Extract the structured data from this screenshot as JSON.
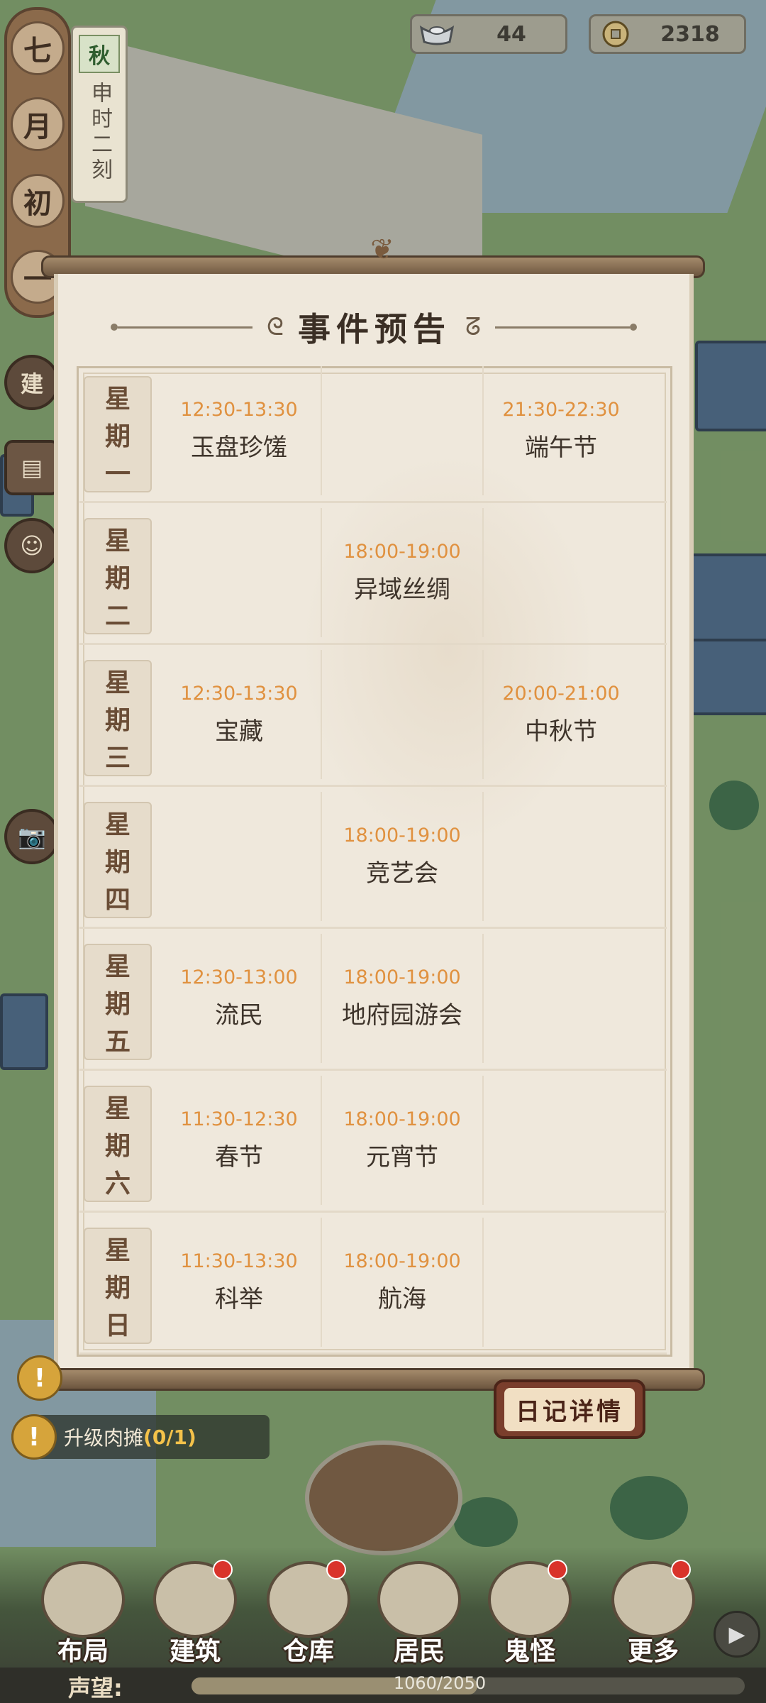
{
  "hud": {
    "date_chars": [
      "七",
      "月",
      "初",
      "一"
    ],
    "season": "秋",
    "time_text": "申时二刻",
    "silver": "44",
    "coins": "2318",
    "silver_icon": "silver-ingot-icon",
    "coin_icon": "copper-coin-icon"
  },
  "side_buttons": [
    "建",
    "📷"
  ],
  "panel": {
    "title": "事件预告",
    "days": [
      {
        "label": [
          "星",
          "期",
          "一"
        ],
        "events": [
          {
            "time": "12:30-13:30",
            "name": "玉盘珍馐"
          },
          {
            "time": "",
            "name": ""
          },
          {
            "time": "21:30-22:30",
            "name": "端午节"
          }
        ]
      },
      {
        "label": [
          "星",
          "期",
          "二"
        ],
        "events": [
          {
            "time": "",
            "name": ""
          },
          {
            "time": "18:00-19:00",
            "name": "异域丝绸"
          },
          {
            "time": "",
            "name": ""
          }
        ]
      },
      {
        "label": [
          "星",
          "期",
          "三"
        ],
        "events": [
          {
            "time": "12:30-13:30",
            "name": "宝藏"
          },
          {
            "time": "",
            "name": ""
          },
          {
            "time": "20:00-21:00",
            "name": "中秋节"
          }
        ]
      },
      {
        "label": [
          "星",
          "期",
          "四"
        ],
        "events": [
          {
            "time": "",
            "name": ""
          },
          {
            "time": "18:00-19:00",
            "name": "竞艺会"
          },
          {
            "time": "",
            "name": ""
          }
        ]
      },
      {
        "label": [
          "星",
          "期",
          "五"
        ],
        "events": [
          {
            "time": "12:30-13:00",
            "name": "流民"
          },
          {
            "time": "18:00-19:00",
            "name": "地府园游会"
          },
          {
            "time": "",
            "name": ""
          }
        ]
      },
      {
        "label": [
          "星",
          "期",
          "六"
        ],
        "events": [
          {
            "time": "11:30-12:30",
            "name": "春节"
          },
          {
            "time": "18:00-19:00",
            "name": "元宵节"
          },
          {
            "time": "",
            "name": ""
          }
        ]
      },
      {
        "label": [
          "星",
          "期",
          "日"
        ],
        "events": [
          {
            "time": "11:30-13:30",
            "name": "科举"
          },
          {
            "time": "18:00-19:00",
            "name": "航海"
          },
          {
            "time": "",
            "name": ""
          }
        ]
      }
    ]
  },
  "diary_button": "日记详情",
  "quest": {
    "text": "升级肉摊",
    "progress": "(0/1)",
    "icon": "!"
  },
  "nav": [
    {
      "label": "布局",
      "badge": false
    },
    {
      "label": "建筑",
      "badge": true
    },
    {
      "label": "仓库",
      "badge": true
    },
    {
      "label": "居民",
      "badge": false
    },
    {
      "label": "鬼怪",
      "badge": true
    },
    {
      "label": "更多",
      "badge": true
    }
  ],
  "fame": {
    "label": "声望:",
    "value": "1060/2050",
    "current": 1060,
    "max": 2050
  },
  "colors": {
    "event_time": "#e0913f",
    "event_name": "#3e342b",
    "paper": "#efe8dc"
  }
}
